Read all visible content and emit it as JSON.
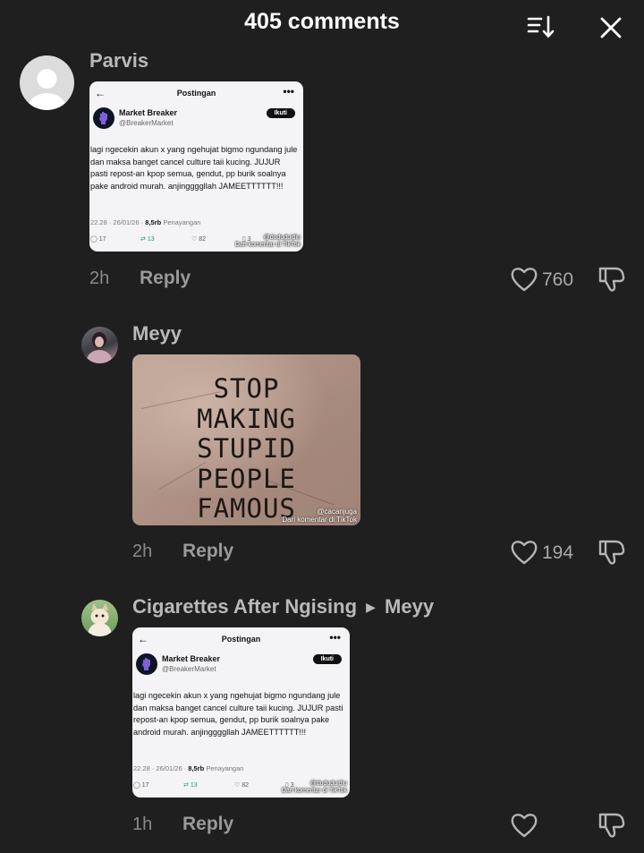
{
  "header": {
    "title": "405 comments"
  },
  "comments": [
    {
      "username": "Parvis",
      "time": "2h",
      "reply_label": "Reply",
      "likes": "760",
      "card": {
        "back": "←",
        "title": "Postingan",
        "dots": "•••",
        "account_name": "Market Breaker",
        "account_handle": "@BreakerMarket",
        "follow_label": "Ikuti",
        "text": "lagi ngecekin akun x yang ngehujat bigmo ngundang jule dan maksa banget cancel culture taii kucing. JUJUR pasti repost-an kpop semua, gendut, pp burik soalnya pake android murah. anjinggggllah JAMEETTTTTT!!!",
        "meta_time": "22.28 · 26/01/26 · ",
        "meta_views": "8,5rb",
        "meta_views_label": " Penayangan",
        "replies": "17",
        "reposts": "13",
        "likes": "82",
        "bookmarks": "3",
        "watermark_user": "@dududuidiu",
        "watermark_note": "Dari komentar di TikTok"
      }
    },
    {
      "username": "Meyy",
      "time": "2h",
      "reply_label": "Reply",
      "likes": "194",
      "image_text": [
        "STOP",
        "MAKING",
        "STUPID",
        "PEOPLE",
        "FAMOUS"
      ],
      "watermark_user": "@cacanjuga",
      "watermark_note": "Dari komentar di TikTok"
    },
    {
      "username": "Cigarettes After Ngising",
      "reply_to": "Meyy",
      "time": "1h",
      "reply_label": "Reply",
      "likes": "",
      "card": {
        "back": "←",
        "title": "Postingan",
        "dots": "•••",
        "account_name": "Market Breaker",
        "account_handle": "@BreakerMarket",
        "follow_label": "Ikuti",
        "text": "lagi ngecekin akun x yang ngehujat bigmo ngundang jule dan maksa banget cancel culture taii kucing. JUJUR pasti repost-an kpop semua, gendut, pp burik soalnya pake android murah. anjinggggllah JAMEETTTTTT!!!",
        "meta_time": "22.28 · 26/01/26 · ",
        "meta_views": "8,5rb",
        "meta_views_label": " Penayangan",
        "replies": "17",
        "reposts": "13",
        "likes": "82",
        "bookmarks": "3",
        "watermark_user": "@dududuidiu",
        "watermark_note": "Dari komentar di TikTok"
      }
    }
  ],
  "icons": {
    "sort": "sort-icon",
    "close": "close-icon",
    "like": "heart-icon",
    "dislike": "thumbs-down-icon",
    "reply_arrow": "triangle-right-icon"
  },
  "colors": {
    "background": "#1f1f1f",
    "username": "#b9b9b9",
    "muted": "#8a8a8a"
  }
}
